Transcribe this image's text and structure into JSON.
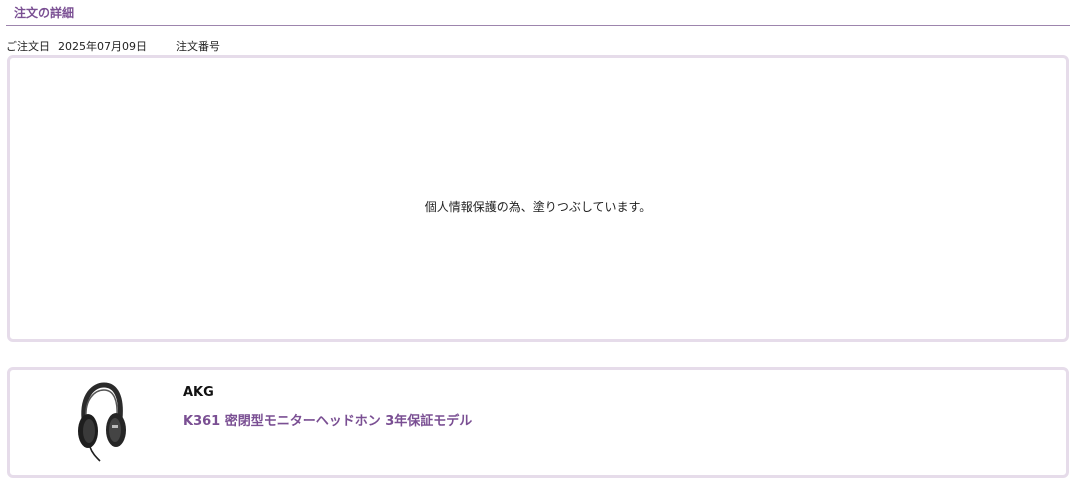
{
  "section": {
    "title": "注文の詳細"
  },
  "order_meta": {
    "date_label": "ご注文日",
    "date_value": "2025年07月09日",
    "order_number_label": "注文番号"
  },
  "masked_notice": {
    "text": "個人情報保護の為、塗りつぶしています。"
  },
  "product": {
    "brand": "AKG",
    "name": "K361 密閉型モニターヘッドホン 3年保証モデル",
    "image_icon": "headphones-icon"
  },
  "colors": {
    "accent": "#7a4f93",
    "card_border": "#e6dcea",
    "rule": "#9d85ad"
  }
}
